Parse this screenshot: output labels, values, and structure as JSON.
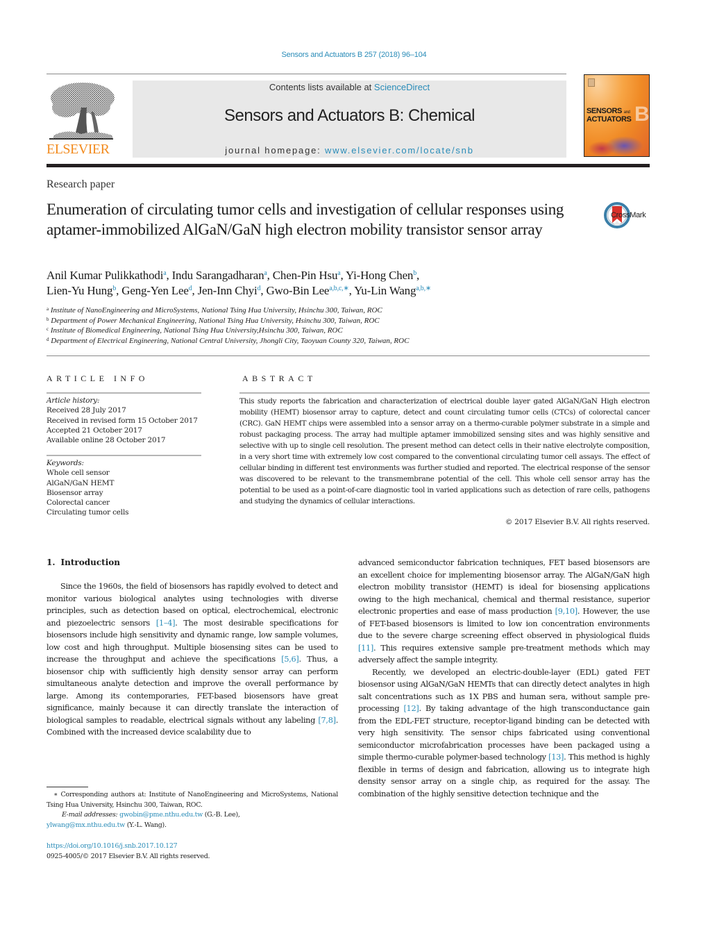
{
  "header": {
    "journal_reference": "Sensors and Actuators B 257 (2018) 96–104",
    "contents_prefix": "Contents lists available at ",
    "contents_link": "ScienceDirect",
    "journal_title": "Sensors and Actuators B: Chemical",
    "homepage_prefix": "journal homepage: ",
    "homepage_link": "www.elsevier.com/locate/snb",
    "publisher_logo_text": "ELSEVIER",
    "cover": {
      "line1": "SENSORS",
      "line1_small": "and",
      "line2": "ACTUATORS",
      "big_letter": "B"
    },
    "colors": {
      "link": "#2a8cb8",
      "elsevier_orange": "#f28b1f",
      "masthead_bg": "#e8e8e8"
    }
  },
  "article": {
    "type": "Research paper",
    "title": "Enumeration of circulating tumor cells and investigation of cellular responses using aptamer-immobilized AlGaN/GaN high electron mobility transistor sensor array",
    "crossmark_label": "CrossMark",
    "authors": [
      {
        "name": "Anil Kumar Pulikkathodi",
        "aff": "a",
        "sep": ", "
      },
      {
        "name": "Indu Sarangadharan",
        "aff": "a",
        "sep": ", "
      },
      {
        "name": "Chen-Pin Hsu",
        "aff": "a",
        "sep": ", "
      },
      {
        "name": "Yi-Hong Chen",
        "aff": "b",
        "sep": ","
      },
      {
        "name": "Lien-Yu Hung",
        "aff": "b",
        "sep": ", "
      },
      {
        "name": "Geng-Yen Lee",
        "aff": "d",
        "sep": ", "
      },
      {
        "name": "Jen-Inn Chyi",
        "aff": "d",
        "sep": ", "
      },
      {
        "name": "Gwo-Bin Lee",
        "aff": "a,b,c,∗",
        "sep": ", "
      },
      {
        "name": "Yu-Lin Wang",
        "aff": "a,b,∗",
        "sep": ""
      }
    ],
    "affiliations": [
      {
        "key": "a",
        "text": "Institute of NanoEngineering and MicroSystems, National Tsing Hua University, Hsinchu 300, Taiwan, ROC"
      },
      {
        "key": "b",
        "text": "Department of Power Mechanical Engineering, National Tsing Hua University, Hsinchu 300, Taiwan, ROC"
      },
      {
        "key": "c",
        "text": "Institute of Biomedical Engineering, National Tsing Hua University,Hsinchu 300, Taiwan, ROC"
      },
      {
        "key": "d",
        "text": "Department of Electrical Engineering, National Central University, Jhongli City, Taoyuan County 320, Taiwan, ROC"
      }
    ]
  },
  "article_info": {
    "heading": "ARTICLE INFO",
    "history_label": "Article history:",
    "history": [
      "Received 28 July 2017",
      "Received in revised form 15 October 2017",
      "Accepted 21 October 2017",
      "Available online 28 October 2017"
    ],
    "keywords_label": "Keywords:",
    "keywords": [
      "Whole cell sensor",
      "AlGaN/GaN HEMT",
      "Biosensor array",
      "Colorectal cancer",
      "Circulating tumor cells"
    ]
  },
  "abstract": {
    "heading": "ABSTRACT",
    "text": "This study reports the fabrication and characterization of electrical double layer gated AlGaN/GaN High electron mobility (HEMT) biosensor array to capture, detect and count circulating tumor cells (CTCs) of colorectal cancer (CRC). GaN HEMT chips were assembled into a sensor array on a thermo-curable polymer substrate in a simple and robust packaging process. The array had multiple aptamer immobilized sensing sites and was highly sensitive and selective with up to single cell resolution. The present method can detect cells in their native electrolyte composition, in a very short time with extremely low cost compared to the conventional circulating tumor cell assays. The effect of cellular binding in different test environments was further studied and reported. The electrical response of the sensor was discovered to be relevant to the transmembrane potential of the cell. This whole cell sensor array has the potential to be used as a point-of-care diagnostic tool in varied applications such as detection of rare cells, pathogens and studying the dynamics of cellular interactions.",
    "copyright": "© 2017 Elsevier B.V. All rights reserved."
  },
  "introduction": {
    "number": "1.",
    "title": "Introduction",
    "left_column": [
      {
        "t": "Since the 1960s, the field of biosensors has rapidly evolved to detect and monitor various biological analytes using technologies with diverse principles, such as detection based on optical, electrochemical, electronic and piezoelectric sensors "
      },
      {
        "ref": "[1–4]"
      },
      {
        "t": ". The most desirable specifications for biosensors include high sensitivity and dynamic range, low sample volumes, low cost and high throughput. Multiple biosensing sites can be used to increase the throughput and achieve the specifications "
      },
      {
        "ref": "[5,6]"
      },
      {
        "t": ". Thus, a biosensor chip with sufficiently high density sensor array can perform simultaneous analyte detection and improve the overall performance by large. Among its contemporaries, FET-based biosensors have great significance, mainly because it can directly translate the interaction of biological samples to readable, electrical signals without any labeling "
      },
      {
        "ref": "[7,8]"
      },
      {
        "t": ". Combined with the increased device scalability due to"
      }
    ],
    "right_column_p1": [
      {
        "t": "advanced semiconductor fabrication techniques, FET based biosensors are an excellent choice for implementing biosensor array. The AlGaN/GaN high electron mobility transistor (HEMT) is ideal for biosensing applications owing to the high mechanical, chemical and thermal resistance, superior electronic properties and ease of mass production "
      },
      {
        "ref": "[9,10]"
      },
      {
        "t": ". However, the use of FET-based biosensors is limited to low ion concentration environments due to the severe charge screening effect observed in physiological fluids "
      },
      {
        "ref": "[11]"
      },
      {
        "t": ". This requires extensive sample pre-treatment methods which may adversely affect the sample integrity."
      }
    ],
    "right_column_p2": [
      {
        "t": "Recently, we developed an electric-double-layer (EDL) gated FET biosensor using AlGaN/GaN HEMTs that can directly detect analytes in high salt concentrations such as 1X PBS and human sera, without sample pre-processing "
      },
      {
        "ref": "[12]"
      },
      {
        "t": ". By taking advantage of the high transconductance gain from the EDL-FET structure, receptor-ligand binding can be detected with very high sensitivity. The sensor chips fabricated using conventional semiconductor microfabrication processes have been packaged using a simple thermo-curable polymer-based technology "
      },
      {
        "ref": "[13]"
      },
      {
        "t": ". This method is highly flexible in terms of design and fabrication, allowing us to integrate high density sensor array on a single chip, as required for the assay. The combination of the highly sensitive detection technique and the"
      }
    ]
  },
  "footnotes": {
    "corresponding_mark": "∗",
    "corresponding_text": "Corresponding authors at: Institute of NanoEngineering and MicroSystems, National Tsing Hua University, Hsinchu 300, Taiwan, ROC.",
    "email_label": "E-mail addresses:",
    "emails": [
      {
        "address": "gwobin@pme.nthu.edu.tw",
        "who": " (G.-B. Lee),"
      },
      {
        "address": "ylwang@mx.nthu.edu.tw",
        "who": " (Y.-L. Wang)."
      }
    ],
    "doi": "https://doi.org/10.1016/j.snb.2017.10.127",
    "issn_line": "0925-4005/© 2017 Elsevier B.V. All rights reserved."
  }
}
